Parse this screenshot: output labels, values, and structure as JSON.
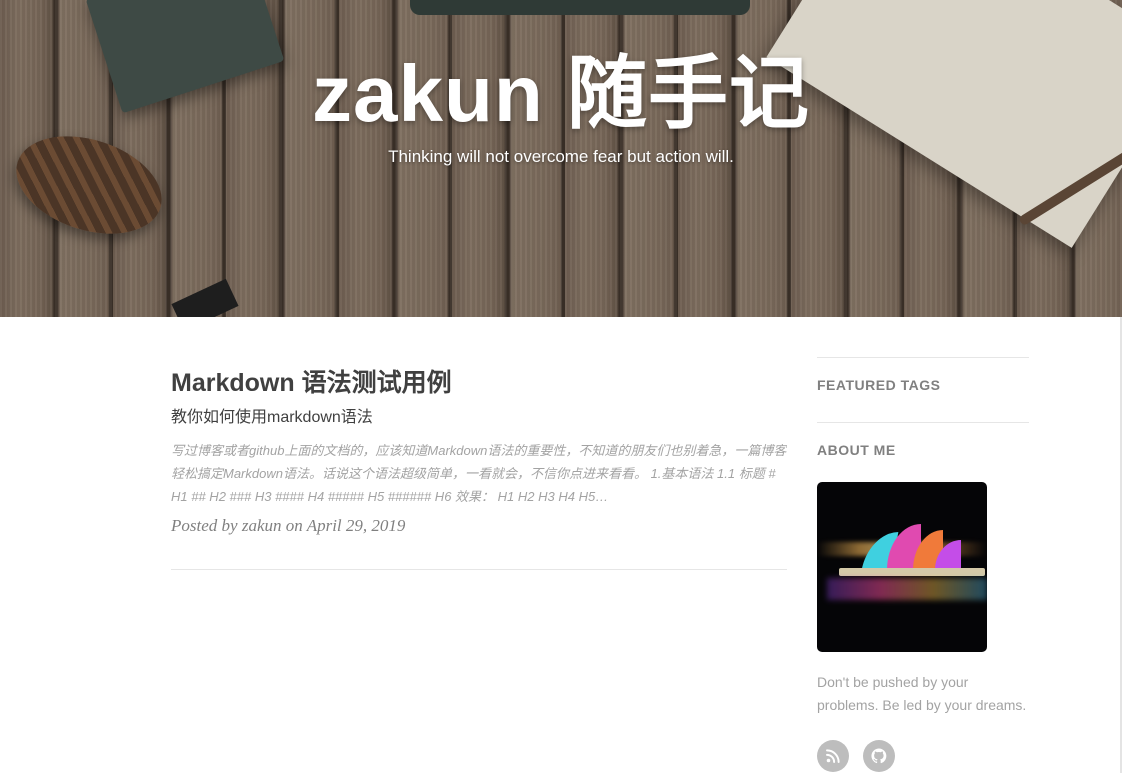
{
  "header": {
    "site_title": "zakun 随手记",
    "site_subtitle": "Thinking will not overcome fear but action will."
  },
  "posts": [
    {
      "title": "Markdown 语法测试用例",
      "subtitle": "教你如何使用markdown语法",
      "excerpt": "写过博客或者github上面的文档的，应该知道Markdown语法的重要性，不知道的朋友们也别着急，一篇博客轻松搞定Markdown语法。话说这个语法超级简单，一看就会，不信你点进来看看。 1.基本语法 1.1 标题 # H1 ## H2 ### H3 #### H4 ##### H5 ###### H6 效果： H1 H2 H3 H4 H5…",
      "meta_prefix": "Posted by",
      "author": "zakun",
      "meta_on": "on",
      "date": "April 29, 2019"
    }
  ],
  "sidebar": {
    "featured_tags_heading": "FEATURED TAGS",
    "about_me_heading": "ABOUT ME",
    "tagline": "Don't be pushed by your problems. Be led by your dreams.",
    "social": [
      {
        "icon": "rss-icon"
      },
      {
        "icon": "github-icon"
      }
    ]
  },
  "colors": {
    "text_dark": "#404040",
    "text_muted": "#a3a3a3",
    "heading_gray": "#808080",
    "social_bg": "#bdbdbd"
  }
}
